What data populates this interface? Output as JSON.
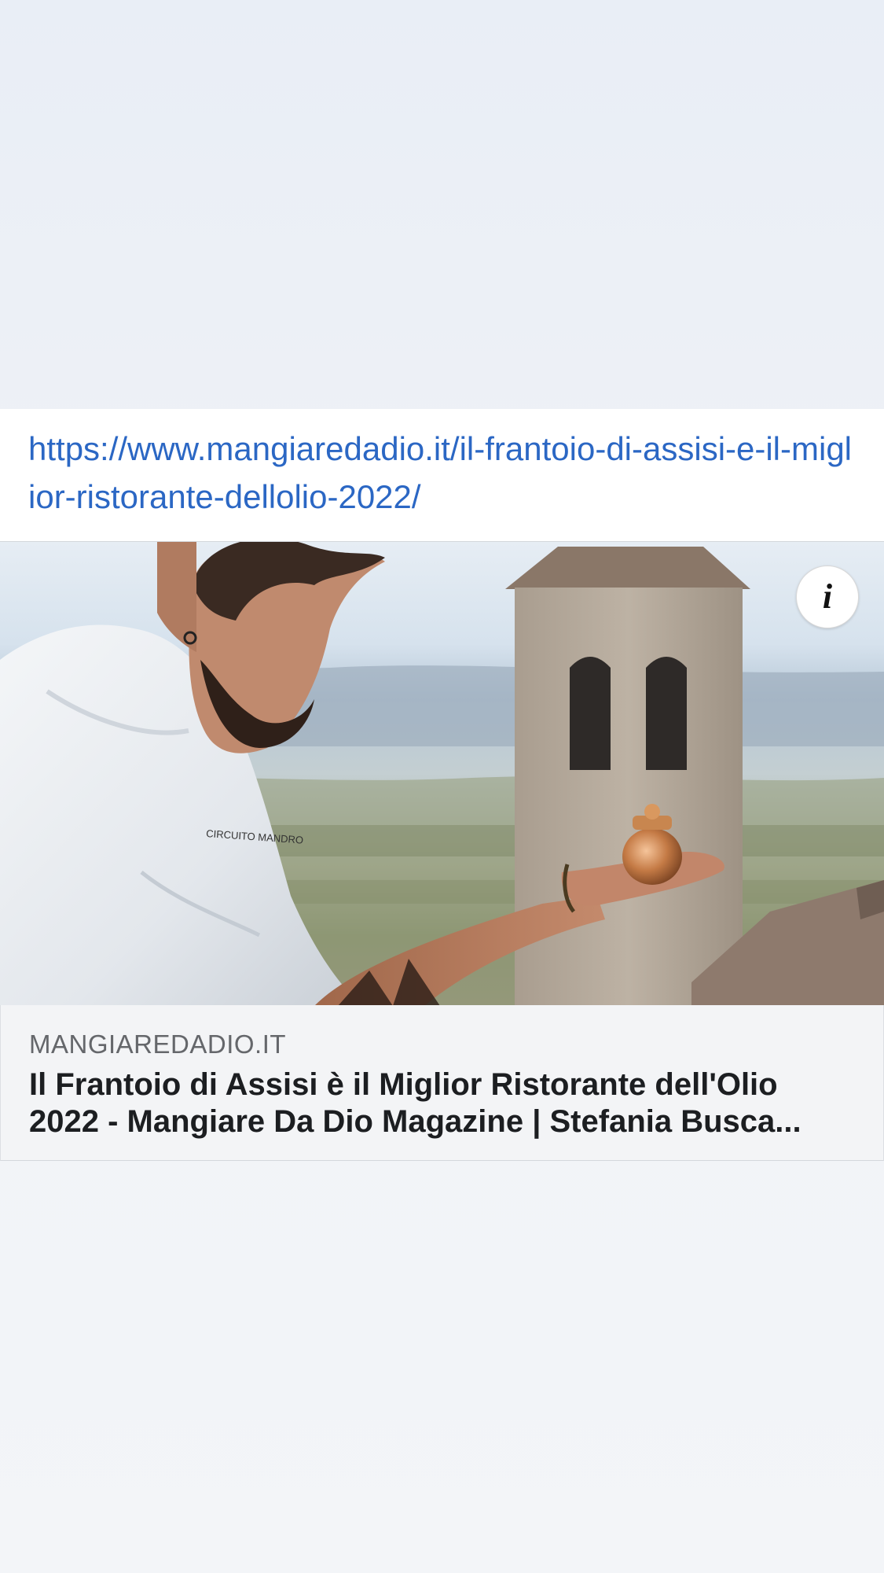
{
  "post": {
    "url": "https://www.mangiaredadio.it/il-frantoio-di-assisi-e-il-miglior-ristorante-dellolio-2022/",
    "preview": {
      "image_jacket_logo": "CIRCUITO MANDRO",
      "info_icon": "info-icon",
      "info_glyph": "i",
      "domain": "MANGIAREDADIO.IT",
      "title": "Il Frantoio di Assisi è il Miglior Ristorante dell'Olio 2022 - Mangiare Da Dio Magazine | Stefania Busca..."
    }
  },
  "colors": {
    "link": "#2b67c4",
    "domain_text": "#65676b",
    "title_text": "#1c1e21",
    "meta_background": "#f3f4f6",
    "page_background": "#eef1f6"
  }
}
